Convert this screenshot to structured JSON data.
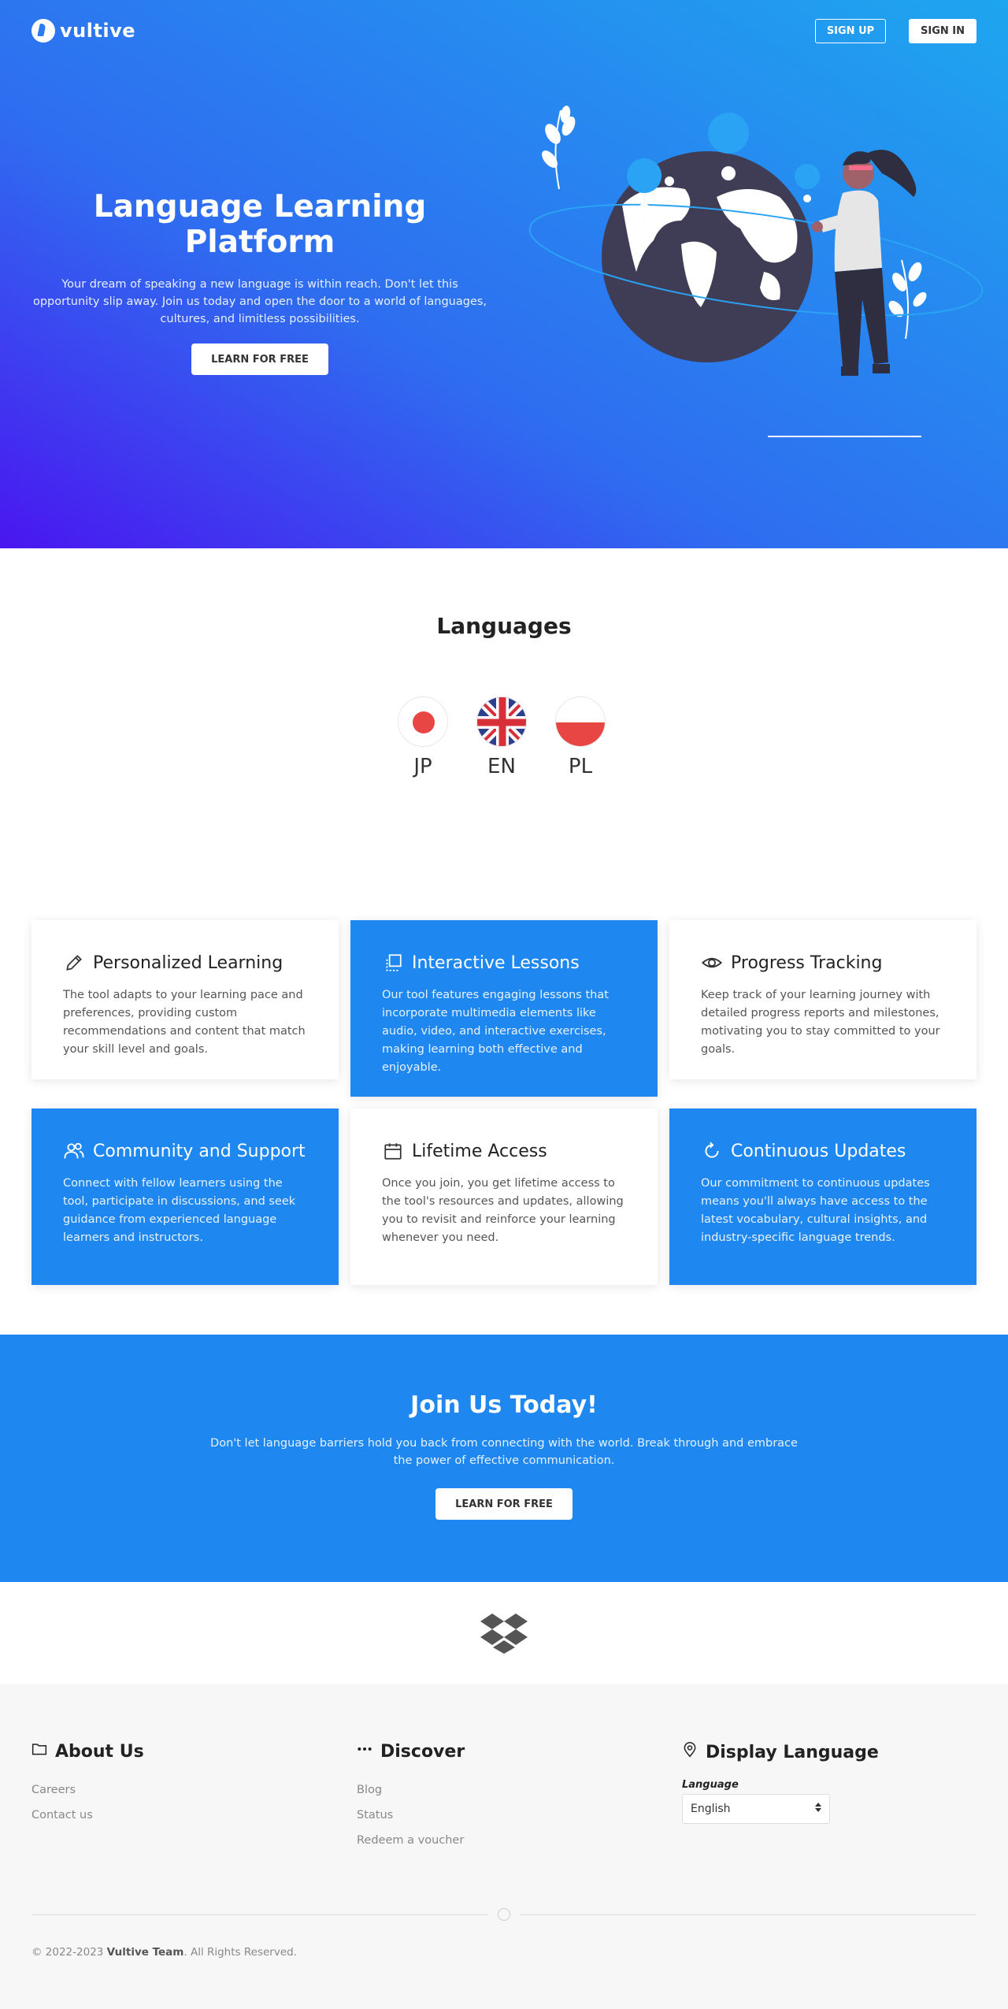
{
  "nav": {
    "logo_text": "vultive",
    "signup_label": "SIGN UP",
    "signin_label": "SIGN IN"
  },
  "hero": {
    "title": "Language Learning Platform",
    "description": "Your dream of speaking a new language is within reach. Don't let this opportunity slip away. Join us today and open the door to a world of languages, cultures, and limitless possibilities.",
    "cta_label": "LEARN FOR FREE"
  },
  "languages": {
    "title": "Languages",
    "items": [
      {
        "code": "JP",
        "flag": "japan-flag-icon"
      },
      {
        "code": "EN",
        "flag": "uk-flag-icon"
      },
      {
        "code": "PL",
        "flag": "poland-flag-icon"
      }
    ]
  },
  "features": [
    {
      "title": "Personalized Learning",
      "icon": "pencil-icon",
      "description": "The tool adapts to your learning pace and preferences, providing custom recommendations and content that match your skill level and goals."
    },
    {
      "title": "Interactive Lessons",
      "icon": "copy-icon",
      "description": "Our tool features engaging lessons that incorporate multimedia elements like audio, video, and interactive exercises, making learning both effective and enjoyable."
    },
    {
      "title": "Progress Tracking",
      "icon": "eye-icon",
      "description": "Keep track of your learning journey with detailed progress reports and milestones, motivating you to stay committed to your goals."
    },
    {
      "title": "Community and Support",
      "icon": "users-icon",
      "description": "Connect with fellow learners using the tool, participate in discussions, and seek guidance from experienced language learners and instructors."
    },
    {
      "title": "Lifetime Access",
      "icon": "calendar-icon",
      "description": "Once you join, you get lifetime access to the tool's resources and updates, allowing you to revisit and reinforce your learning whenever you need."
    },
    {
      "title": "Continuous Updates",
      "icon": "refresh-icon",
      "description": "Our commitment to continuous updates means you'll always have access to the latest vocabulary, cultural insights, and industry-specific language trends."
    }
  ],
  "join": {
    "title": "Join Us Today!",
    "description": "Don't let language barriers hold you back from connecting with the world. Break through and embrace the power of effective communication.",
    "cta_label": "LEARN FOR FREE"
  },
  "footer": {
    "about": {
      "title": "About Us",
      "icon": "folder-icon",
      "links": [
        "Careers",
        "Contact us"
      ]
    },
    "discover": {
      "title": "Discover",
      "icon": "dots-icon",
      "links": [
        "Blog",
        "Status",
        "Redeem a voucher"
      ]
    },
    "display_language": {
      "title": "Display Language",
      "icon": "location-pin-icon",
      "label": "Language",
      "selected": "English"
    },
    "copyright_prefix": "© 2022-2023 ",
    "copyright_team": "Vultive Team",
    "copyright_suffix": ". All Rights Reserved."
  },
  "colors": {
    "accent_blue": "#1e88f0",
    "hero_gradient_start": "#4a16f0",
    "hero_gradient_end": "#1ea6ef"
  }
}
